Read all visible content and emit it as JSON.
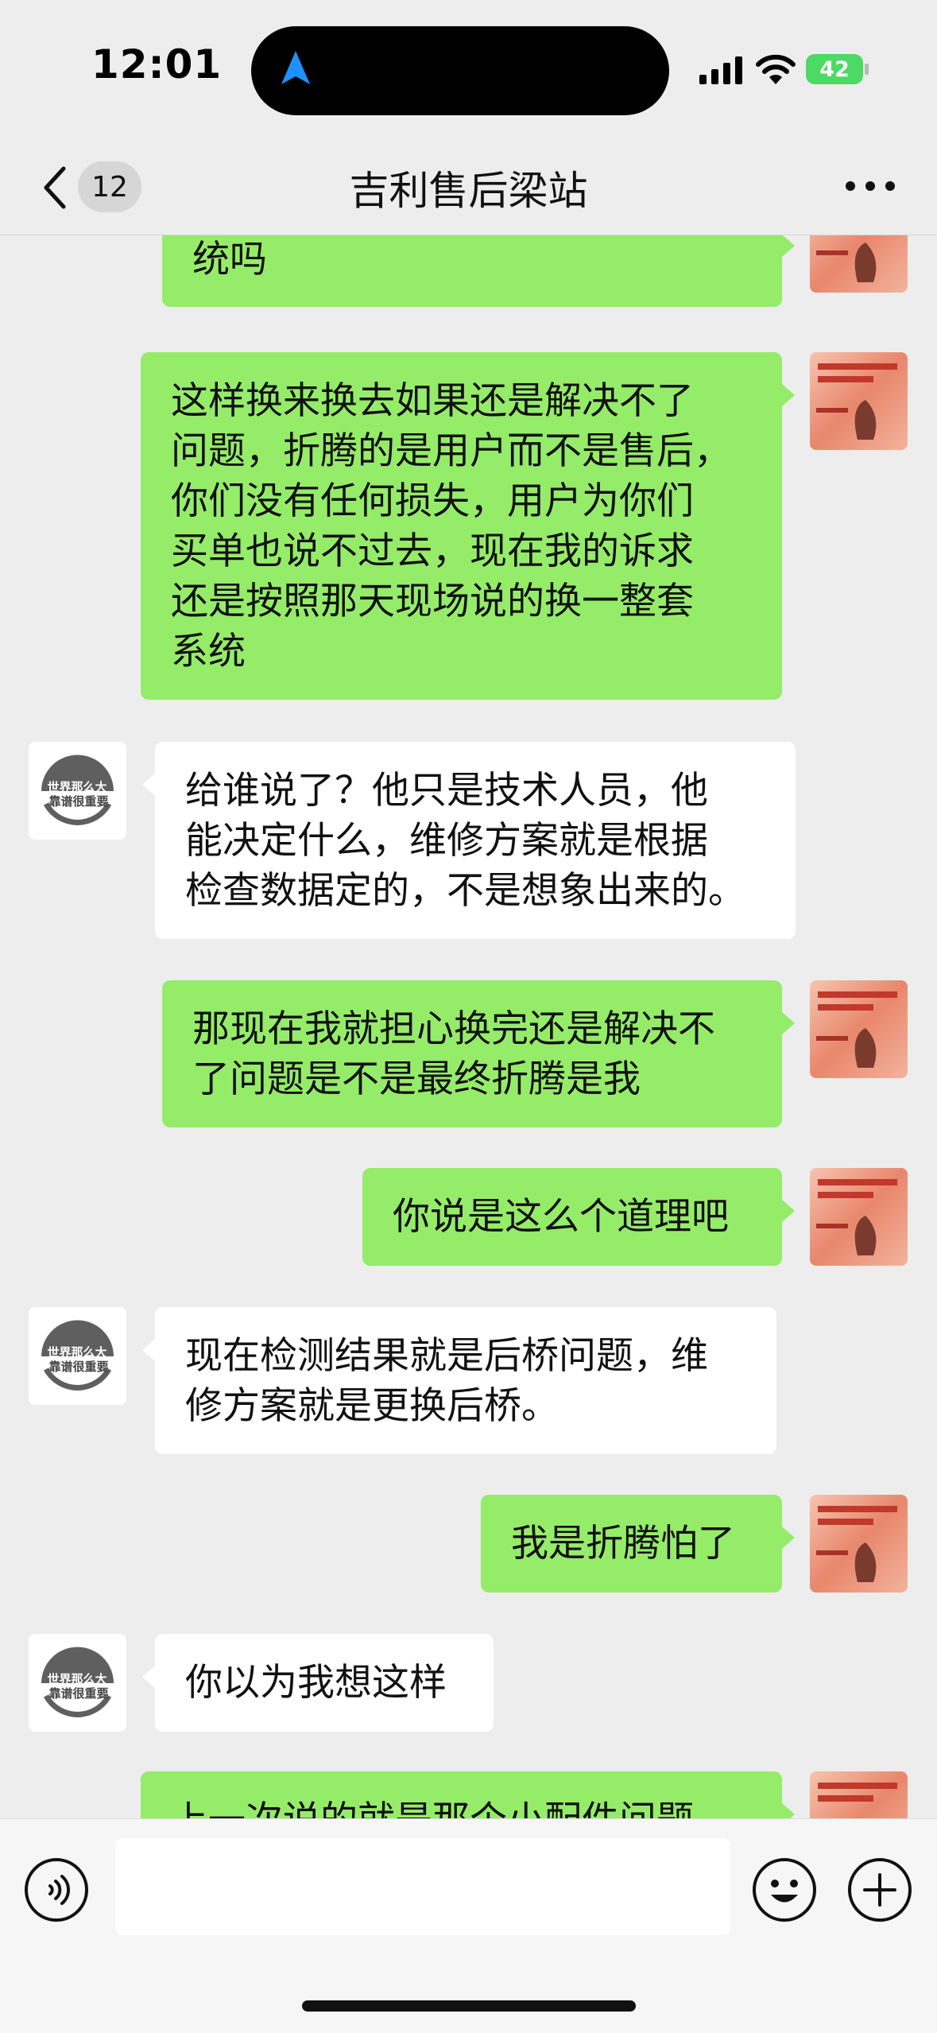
{
  "status_bar": {
    "time": "12:01",
    "battery": "42"
  },
  "header": {
    "back_badge": "12",
    "title": "吉利售后梁站"
  },
  "avatars": {
    "other_text_line1": "世界那么大",
    "other_text_line2": "靠谱很重要"
  },
  "messages": [
    {
      "sender": "me",
      "lines": [
        "统吗"
      ]
    },
    {
      "sender": "me",
      "lines": [
        "这样换来换去如果还是解决不了",
        "问题，折腾的是用户而不是售后，",
        "你们没有任何损失，用户为你们",
        "买单也说不过去，现在我的诉求",
        "还是按照那天现场说的换一整套",
        "系统"
      ]
    },
    {
      "sender": "other",
      "lines": [
        "给谁说了？他只是技术人员，他",
        "能决定什么，维修方案就是根据",
        "检查数据定的，不是想象出来的。"
      ]
    },
    {
      "sender": "me",
      "lines": [
        "那现在我就担心换完还是解决不",
        "了问题是不是最终折腾是我"
      ]
    },
    {
      "sender": "me",
      "lines": [
        "你说是这么个道理吧"
      ]
    },
    {
      "sender": "other",
      "lines": [
        "现在检测结果就是后桥问题，维",
        "修方案就是更换后桥。"
      ]
    },
    {
      "sender": "me",
      "lines": [
        "我是折腾怕了"
      ]
    },
    {
      "sender": "other",
      "lines": [
        "你以为我想这样"
      ]
    },
    {
      "sender": "me",
      "lines": [
        "上一次说的就是那个小配件问题"
      ]
    }
  ],
  "input": {
    "placeholder": ""
  }
}
